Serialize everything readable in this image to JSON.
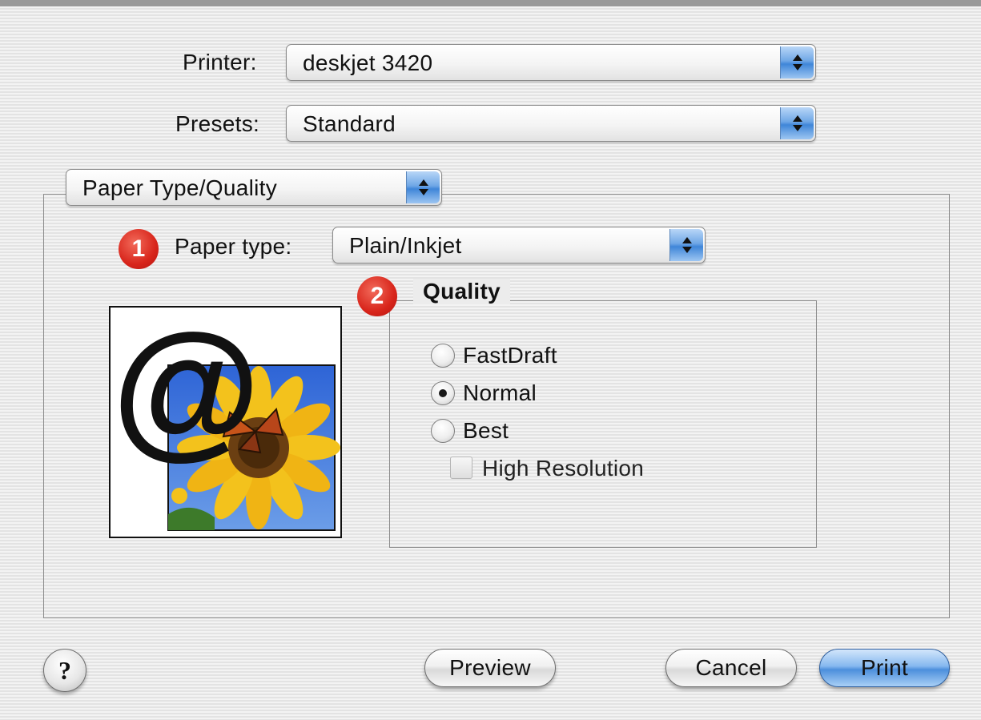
{
  "printer": {
    "label": "Printer:",
    "value": "deskjet 3420"
  },
  "presets": {
    "label": "Presets:",
    "value": "Standard"
  },
  "panel_menu": {
    "value": "Paper Type/Quality"
  },
  "paper_type": {
    "badge": "1",
    "label": "Paper type:",
    "value": "Plain/Inkjet"
  },
  "quality": {
    "badge": "2",
    "title": "Quality",
    "options": [
      {
        "label": "FastDraft",
        "selected": false
      },
      {
        "label": "Normal",
        "selected": true
      },
      {
        "label": "Best",
        "selected": false
      }
    ],
    "high_resolution": {
      "label": "High Resolution",
      "checked": false,
      "enabled": false
    }
  },
  "preview_image": {
    "glyph": "@"
  },
  "footer": {
    "help_label": "?",
    "preview_label": "Preview",
    "cancel_label": "Cancel",
    "print_label": "Print"
  },
  "icons": {
    "popup_arrows": "up-down-arrows-icon",
    "help": "help-icon",
    "paper_preview": "sunflower-at-preview-icon"
  },
  "colors": {
    "accent_blue": "#4c8fdc",
    "badge_red": "#d8251b"
  }
}
